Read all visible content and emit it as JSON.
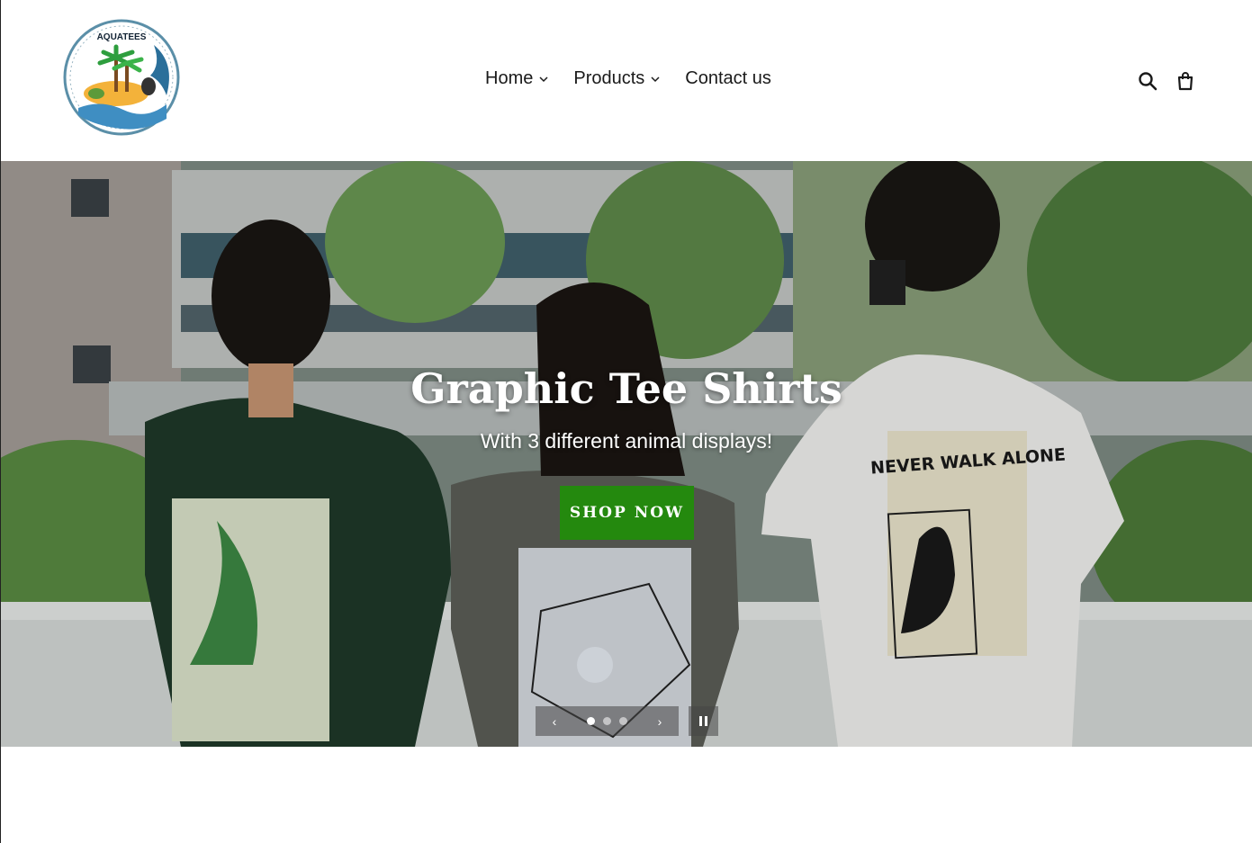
{
  "header": {
    "logo_text": "AQUATEES",
    "nav": [
      {
        "label": "Home",
        "has_dropdown": true
      },
      {
        "label": "Products",
        "has_dropdown": true
      },
      {
        "label": "Contact us",
        "has_dropdown": false
      }
    ],
    "icons": [
      "search-icon",
      "cart-icon"
    ]
  },
  "hero": {
    "title": "Graphic Tee Shirts",
    "subtitle": "With 3 different animal displays!",
    "button_label": "SHOP NOW",
    "button_color": "#24890e",
    "slides_total": 3,
    "active_slide": 1,
    "shirt_text": "NEVER WALK ALONE"
  }
}
